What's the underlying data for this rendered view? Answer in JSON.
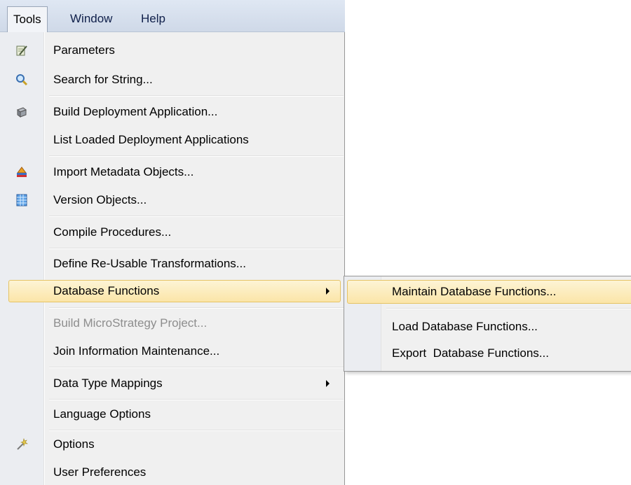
{
  "menubar": {
    "items": [
      {
        "label": "Tools"
      },
      {
        "label": "Window"
      },
      {
        "label": "Help"
      }
    ]
  },
  "tools_menu": {
    "items": [
      {
        "label": "Parameters",
        "icon": "parameters-icon"
      },
      {
        "label": "Search for String...",
        "icon": "search-icon"
      },
      {
        "label": "Build Deployment Application...",
        "icon": "deployment-icon"
      },
      {
        "label": "List Loaded Deployment Applications"
      },
      {
        "label": "Import Metadata Objects...",
        "icon": "import-icon"
      },
      {
        "label": "Version Objects...",
        "icon": "grid-icon"
      },
      {
        "label": "Compile Procedures..."
      },
      {
        "label": "Define Re-Usable Transformations..."
      },
      {
        "label": "Database Functions",
        "submenu": true,
        "highlighted": true
      },
      {
        "label": "Build MicroStrategy Project...",
        "disabled": true
      },
      {
        "label": "Join Information Maintenance..."
      },
      {
        "label": "Data Type Mappings",
        "submenu": true
      },
      {
        "label": "Language Options"
      },
      {
        "label": "Options",
        "icon": "wand-icon"
      },
      {
        "label": "User Preferences"
      }
    ]
  },
  "database_functions_submenu": {
    "items": [
      {
        "label": "Maintain Database Functions...",
        "highlighted": true
      },
      {
        "label": "Load Database Functions..."
      },
      {
        "label": "Export  Database Functions..."
      }
    ]
  },
  "colors": {
    "highlight": "#fbe5a8",
    "highlight_border": "#e5c365",
    "menu_bg": "#f0f0f0",
    "menubar_bg": "#d6dfeb",
    "disabled_text": "#8d8d8d"
  }
}
